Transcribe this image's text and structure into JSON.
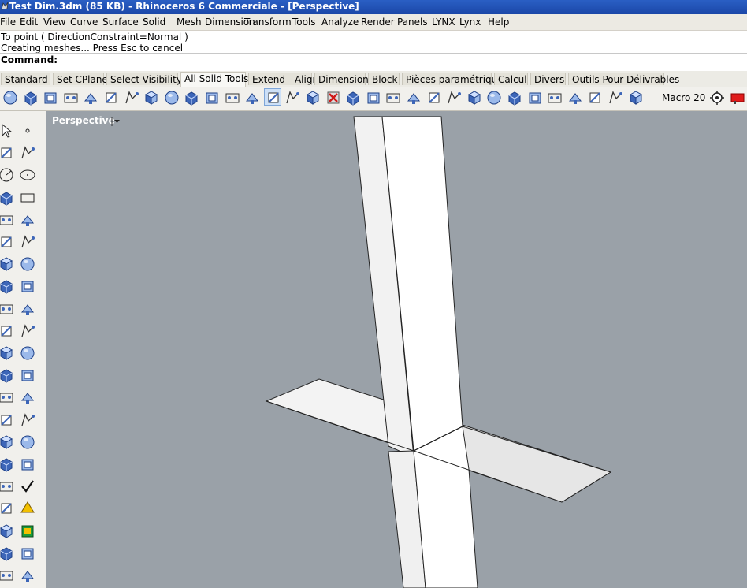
{
  "window": {
    "title": "Test Dim.3dm (85 KB) - Rhinoceros 6 Commerciale - [Perspective]"
  },
  "menu": [
    "File",
    "Edit",
    "View",
    "Curve",
    "Surface",
    "Solid",
    "Mesh",
    "Dimension",
    "Transform",
    "Tools",
    "Analyze",
    "Render",
    "Panels",
    "LYNX",
    "Lynx",
    "Help"
  ],
  "command_history": [
    "To point ( DirectionConstraint=Normal )",
    "Creating meshes... Press Esc to cancel"
  ],
  "command_prompt": {
    "label": "Command:",
    "value": ""
  },
  "tabs": [
    {
      "label": "Standard",
      "active": false
    },
    {
      "label": "Set CPlane",
      "active": false
    },
    {
      "label": "Select-Visibility",
      "active": false
    },
    {
      "label": "All Solid Tools",
      "active": true
    },
    {
      "label": "Extend - Align",
      "active": false
    },
    {
      "label": "Dimension",
      "active": false
    },
    {
      "label": "Block",
      "active": false
    },
    {
      "label": "Pièces paramétrique",
      "active": false
    },
    {
      "label": "Calcul",
      "active": false
    },
    {
      "label": "Divers",
      "active": false
    },
    {
      "label": "Outils Pour Délivrables",
      "active": false
    }
  ],
  "toolbar": {
    "macro_label": "Macro 20",
    "icons": [
      "sphere-icon",
      "sphere-2pt-icon",
      "sphere-3pt-icon",
      "box-corner-icon",
      "box-3pt-icon",
      "box-bounding-icon",
      "layer-stack-icon",
      "box-solid-icon",
      "box-solid-2-icon",
      "extrude-solid-icon",
      "cylinder-cap-icon",
      "box-frame-icon",
      "boolean-union-icon",
      "box-selected-icon",
      "grid-array-icon",
      "grid-array-2-icon",
      "delete-faces-icon",
      "split-solid-icon",
      "extrude-face-icon",
      "move-face-icon",
      "move-edge-icon",
      "shell-icon",
      "offset-face-icon",
      "blend-edge-icon",
      "chamfer-edge-icon",
      "solid-edit-icon",
      "wirecut-icon",
      "pipe-icon",
      "boolean-split-icon",
      "solid-point-icon",
      "cube-icon",
      "connect-icon",
      "options-gear-icon",
      "red-macro-icon"
    ]
  },
  "sidebar": {
    "icons": [
      "select-arrow-icon",
      "point-icon",
      "polyline-icon",
      "curve-cv-icon",
      "circle-icon",
      "ellipse-icon",
      "arc-icon",
      "rectangle-icon",
      "polygon-icon",
      "fillet-curve-icon",
      "surface-patch-icon",
      "surface-sweep-icon",
      "box-icon",
      "sphere-icon",
      "cylinder-icon",
      "mesh-surface-icon",
      "gear-edit-icon",
      "explode-icon",
      "trim-icon",
      "split-icon",
      "group-icon",
      "boolean-icon",
      "rotate-icon",
      "offset-curve-icon",
      "text-icon",
      "dimension-icon",
      "array-icon",
      "align-icon",
      "box-edit-icon",
      "move-points-icon",
      "grid-icon",
      "array-linear-icon",
      "tube-icon",
      "check-icon",
      "pyramid-icon",
      "cone-color-icon",
      "axis-icon",
      "layer-color-icon",
      "properties-icon",
      "layout-icon",
      "view-cube-icon",
      "cplane-icon"
    ]
  },
  "viewport": {
    "label": "Perspective",
    "background": "#9aa1a8"
  }
}
